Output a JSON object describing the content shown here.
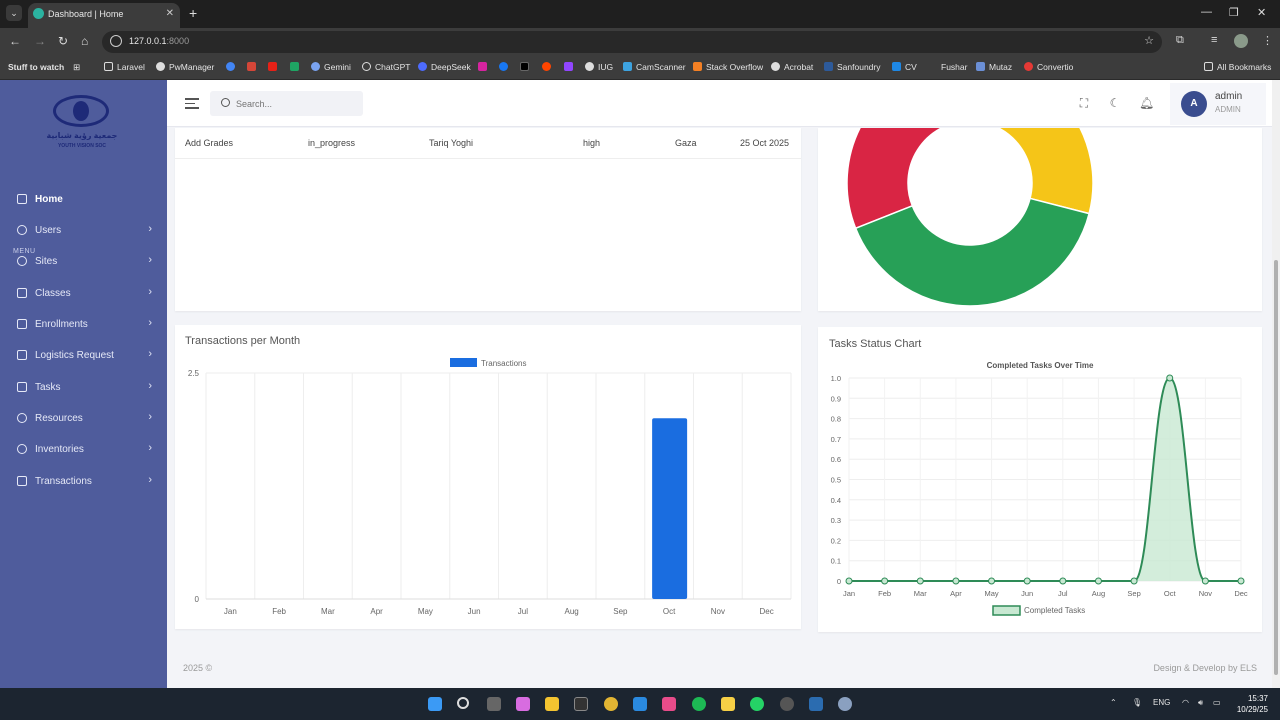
{
  "browser": {
    "tab_title": "Dashboard | Home",
    "url_host": "127.0.0.1",
    "url_port": ":8000",
    "bookmarks_left": "Stuff to watch",
    "bookmarks": [
      "Laravel",
      "PwManager",
      "Gemini",
      "ChatGPT",
      "DeepSeek",
      "IUG",
      "CamScanner",
      "Stack Overflow",
      "Acrobat",
      "Sanfoundry",
      "CV",
      "Fushar",
      "Mutaz",
      "Convertio"
    ],
    "all_bookmarks": "All Bookmarks"
  },
  "sidebar": {
    "logo_arabic": "جمعية رؤية شبابية",
    "logo_english": "YOUTH VISION SOC",
    "menu_label": "MENU",
    "items": [
      {
        "label": "Home"
      },
      {
        "label": "Users"
      },
      {
        "label": "Sites"
      },
      {
        "label": "Classes"
      },
      {
        "label": "Enrollments"
      },
      {
        "label": "Logistics Request"
      },
      {
        "label": "Tasks"
      },
      {
        "label": "Resources"
      },
      {
        "label": "Inventories"
      },
      {
        "label": "Transactions"
      }
    ]
  },
  "topbar": {
    "search_placeholder": "Search...",
    "user_name": "admin",
    "user_role": "ADMIN",
    "avatar_letter": "A"
  },
  "task_table": {
    "row": [
      "Add Grades",
      "in_progress",
      "Tariq Yoghi",
      "high",
      "Gaza",
      "25 Oct 2025"
    ]
  },
  "transactions_card": {
    "title": "Transactions per Month"
  },
  "tasks_card": {
    "title": "Tasks Status Chart"
  },
  "chart_data": [
    {
      "type": "pie",
      "chart_style": "doughnut",
      "labels": [
        "",
        "",
        ""
      ],
      "values": [
        3,
        3,
        4
      ],
      "colors": [
        "#d92544",
        "#f5c518",
        "#27a057"
      ],
      "note": "partially visible, top cropped"
    },
    {
      "type": "bar",
      "categories": [
        "Jan",
        "Feb",
        "Mar",
        "Apr",
        "May",
        "Jun",
        "Jul",
        "Aug",
        "Sep",
        "Oct",
        "Nov",
        "Dec"
      ],
      "series": [
        {
          "name": "Transactions",
          "values": [
            0,
            0,
            0,
            0,
            0,
            0,
            0,
            0,
            0,
            2,
            0,
            0
          ]
        }
      ],
      "yticks": [
        "2.5",
        "0"
      ],
      "ylim": [
        0,
        2.5
      ],
      "color": "#1a6de0",
      "legend": "top",
      "grid": true
    },
    {
      "type": "line",
      "title": "Completed Tasks Over Time",
      "categories": [
        "Jan",
        "Feb",
        "Mar",
        "Apr",
        "May",
        "Jun",
        "Jul",
        "Aug",
        "Sep",
        "Oct",
        "Nov",
        "Dec"
      ],
      "series": [
        {
          "name": "Completed Tasks",
          "values": [
            0,
            0,
            0,
            0,
            0,
            0,
            0,
            0,
            0,
            1,
            0,
            0
          ]
        }
      ],
      "yticks": [
        "1.0",
        "0.9",
        "0.8",
        "0.7",
        "0.6",
        "0.5",
        "0.4",
        "0.3",
        "0.2",
        "0.1",
        "0"
      ],
      "ylim": [
        0,
        1
      ],
      "color": "#2e8b57",
      "fill": "#c8e8d2",
      "legend": "bottom",
      "grid": true
    }
  ],
  "footer": {
    "left": "2025 ©",
    "right": "Design & Develop by ELS"
  },
  "taskbar": {
    "lang": "ENG",
    "time": "15:37",
    "date": "10/29/25"
  }
}
